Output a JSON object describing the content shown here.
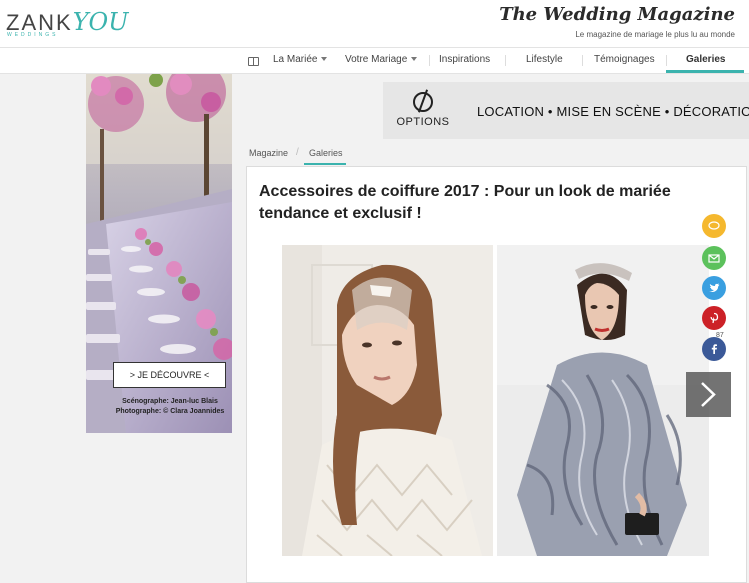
{
  "header": {
    "logo_main": "ZANK",
    "logo_you": "YOU",
    "logo_sub": "WEDDINGS",
    "magazine_title": "The Wedding Magazine",
    "magazine_subtitle": "Le magazine de mariage le plus lu au monde"
  },
  "nav": {
    "items": [
      {
        "label": "La Mariée"
      },
      {
        "label": "Votre Mariage"
      },
      {
        "label": "Inspirations"
      },
      {
        "label": "Lifestyle"
      },
      {
        "label": "Témoignages"
      },
      {
        "label": "Galeries"
      }
    ],
    "active": "Galeries"
  },
  "side_ad": {
    "cta": "> JE DÉCOUVRE <",
    "credit_line1": "Scénographe: Jean-luc Blais",
    "credit_line2": "Photographe: © Clara Joannides"
  },
  "options_banner": {
    "logo_label": "OPTIONS",
    "tagline_1": "LOCATION",
    "tagline_2": "MISE EN SCÈNE",
    "tagline_3": "DÉCORATION",
    "separator": "•"
  },
  "breadcrumb": {
    "items": [
      "Magazine",
      "Galeries"
    ],
    "separator": "/"
  },
  "article": {
    "title": "Accessoires de coiffure 2017 : Pour un look de mariée tendance et exclusif !"
  },
  "share": {
    "facebook_count": "87"
  },
  "colors": {
    "accent": "#3bb3ae",
    "comment": "#f5b82e",
    "email": "#5cc15c",
    "twitter": "#3a9fe0",
    "pinterest": "#cc2127",
    "facebook": "#3b5998"
  },
  "icons": [
    "book-icon",
    "options-icon",
    "chevron-right-icon",
    "comment-icon",
    "email-icon",
    "twitter-icon",
    "pinterest-icon",
    "facebook-icon"
  ]
}
